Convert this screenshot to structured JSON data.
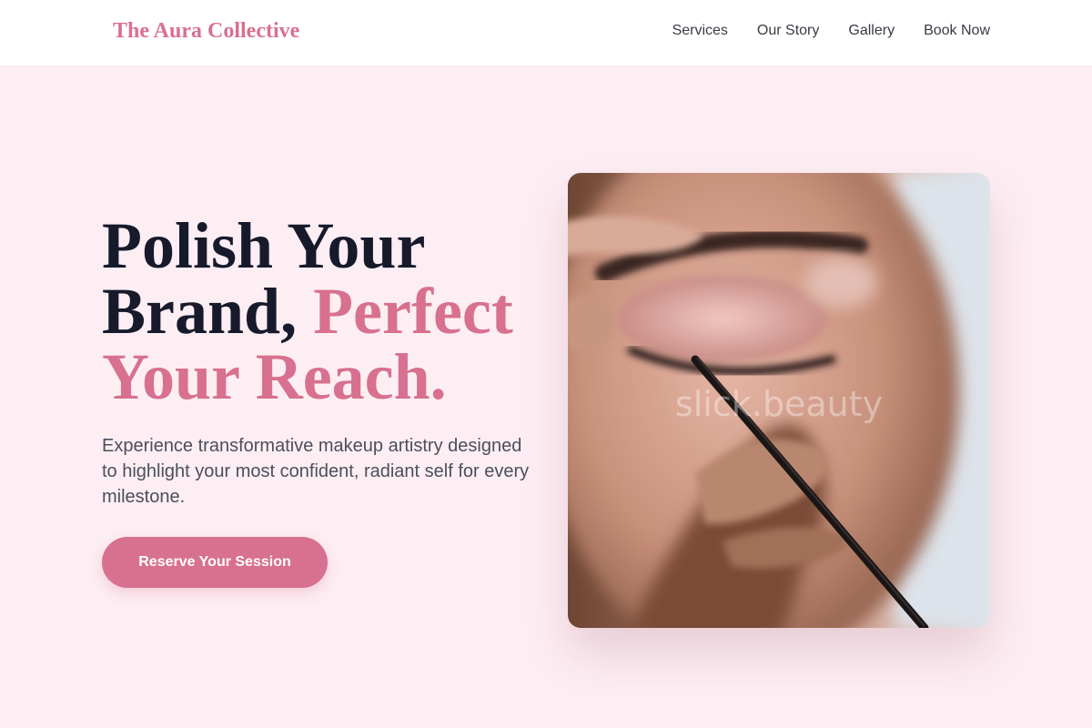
{
  "header": {
    "logo": "The Aura Collective",
    "nav": [
      "Services",
      "Our Story",
      "Gallery",
      "Book Now"
    ]
  },
  "hero": {
    "title_line1": "Polish Your",
    "title_line2_dark": "Brand, ",
    "title_line2_accent": "Perfect",
    "title_line3_accent": "Your Reach.",
    "description": "Experience transformative makeup artistry designed to highlight your most confident, radiant self for every milestone.",
    "cta_label": "Reserve Your Session",
    "image_watermark": "slick.beauty"
  },
  "colors": {
    "brand_pink": "#d8708f",
    "page_background": "#fdeef3",
    "heading_dark": "#161a2b"
  }
}
